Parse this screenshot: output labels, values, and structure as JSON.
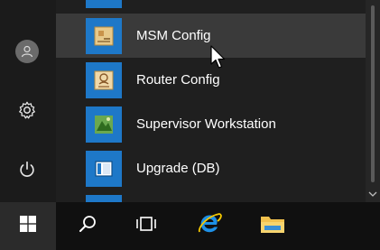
{
  "start_menu": {
    "apps": [
      {
        "label": "MSM Config",
        "icon": "msm-config-icon",
        "hovered": true
      },
      {
        "label": "Router Config",
        "icon": "router-config-icon",
        "hovered": false
      },
      {
        "label": "Supervisor Workstation",
        "icon": "supervisor-workstation-icon",
        "hovered": false
      },
      {
        "label": "Upgrade (DB)",
        "icon": "upgrade-db-icon",
        "hovered": false
      }
    ],
    "rail": [
      "user-avatar-icon",
      "settings-gear-icon",
      "power-icon"
    ]
  },
  "taskbar": {
    "items": [
      "windows-start-icon",
      "search-icon",
      "task-view-icon",
      "internet-explorer-icon",
      "file-explorer-icon"
    ]
  },
  "colors": {
    "tile_blue": "#1e78c8",
    "menu_bg": "#1f1f1f",
    "taskbar_bg": "#101010",
    "hover_bg": "#3a3a3a"
  }
}
